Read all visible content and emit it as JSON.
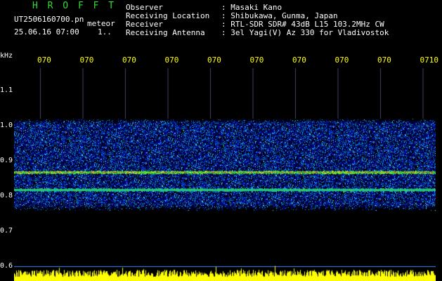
{
  "header": {
    "brand": "H R O F F T",
    "file_name": "UT2506160700.pn",
    "file_suffix": "meteor",
    "datetime": "25.06.16 07:00",
    "datetime_extra": "1..",
    "observer": {
      "label": "Observer",
      "value": ": Masaki Kano"
    },
    "location": {
      "label": "Receiving Location",
      "value": ": Shibukawa, Gunma, Japan"
    },
    "receiver": {
      "label": "Receiver",
      "value": ": RTL-SDR SDR# 43dB L15 103.2MHz CW"
    },
    "antenna": {
      "label": "Receiving Antenna",
      "value": ": 3el Yagi(V) Az 330 for Vladivostok"
    }
  },
  "colors": {
    "brand": "#33dd33",
    "header_text": "#ffffff",
    "axis_labels": "#ffffff",
    "time_labels": "#ffff00",
    "time_grid": "#444466",
    "baseline_line": "#4488ff",
    "level_trace": "#ffff00"
  },
  "chart_data": {
    "type": "heatmap",
    "y_unit_label": "kHz",
    "y_ticks": [
      "1.1",
      "1.0",
      "0.9",
      "0.8",
      "0.7",
      "0.6"
    ],
    "ylim": [
      0.6,
      1.1
    ],
    "x_ticks": [
      "070",
      "070",
      "070",
      "070",
      "070",
      "070",
      "070",
      "070",
      "070",
      "0710"
    ],
    "noise_band_khz": [
      0.78,
      1.01
    ],
    "signal_lines_khz": [
      0.87,
      0.82
    ],
    "level_baseline_khz": 0.6
  }
}
